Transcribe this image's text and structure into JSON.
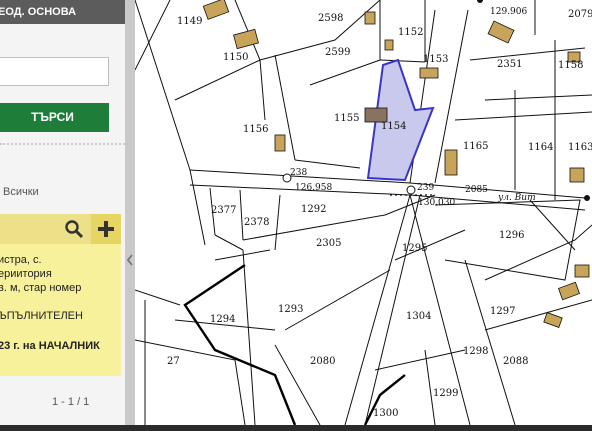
{
  "panel": {
    "header_title": "ЕОД. ОСНОВА",
    "search_input_value": "",
    "search_button": "ТЪРСИ",
    "filter_all": "Всички",
    "result_lines": [
      "истра, с.",
      "ериитория",
      "в. м, стар номер",
      "ЪПЪЛНИТЕЛЕН",
      "23 г. на НАЧАЛНИК"
    ],
    "pagination": "1 - 1 / 1",
    "icons": {
      "search": "search-icon",
      "add": "plus-icon",
      "collapse": "chevron-left-icon"
    }
  },
  "map": {
    "highlight_color": "#c9c9ee",
    "highlight_border": "#3a36c4",
    "parcels": [
      "1149",
      "2598",
      "1152",
      "2079",
      "1150",
      "2599",
      "1153",
      "2351",
      "1158",
      "1156",
      "1155",
      "1154",
      "1165",
      "1164",
      "1163",
      "2377",
      "2378",
      "1292",
      "2305",
      "1295",
      "1296",
      "1293",
      "1294",
      "1304",
      "1297",
      "27",
      "2080",
      "1298",
      "2088",
      "1299",
      "1300"
    ],
    "elevations": [
      "129.906",
      "126.958",
      "130.030"
    ],
    "point_numbers": [
      "238",
      "239",
      "2085"
    ],
    "street_name": "ул. Вит"
  }
}
